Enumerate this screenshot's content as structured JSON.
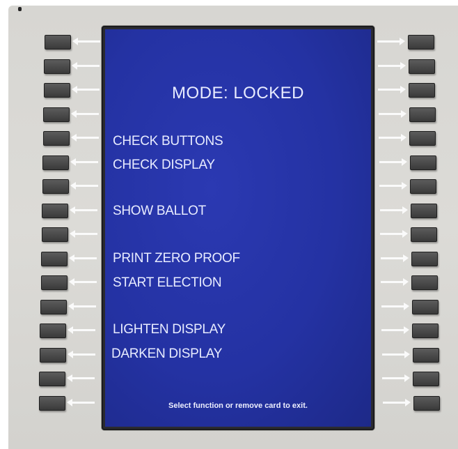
{
  "screen": {
    "title": "MODE: LOCKED",
    "menu_items": [
      "CHECK BUTTONS",
      "CHECK DISPLAY",
      "SHOW BALLOT",
      "PRINT ZERO PROOF",
      "START ELECTION",
      "LIGHTEN DISPLAY",
      "DARKEN DISPLAY"
    ],
    "footer": "Select function or remove card to exit."
  },
  "colors": {
    "screen_blue": "#2432a3",
    "text": "#e8ecff",
    "bezel": "#2b2b30",
    "panel": "#d7d6d2",
    "button": "#3a3a3a"
  },
  "side_buttons": {
    "left_count": 16,
    "right_count": 16,
    "left_icon": "left-arrow-icon",
    "right_icon": "right-arrow-icon"
  }
}
